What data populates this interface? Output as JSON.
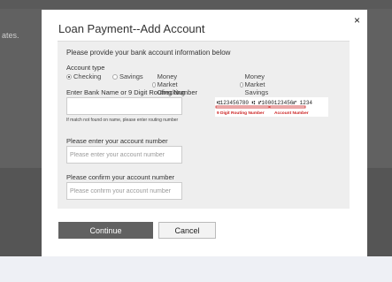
{
  "background": {
    "side_text": "ates."
  },
  "modal": {
    "title": "Loan Payment--Add Account",
    "close_glyph": "×",
    "intro": "Please provide your bank account information below",
    "account_type_label": "Account type",
    "account_types": [
      {
        "label": "Checking",
        "selected": true
      },
      {
        "label": "Savings",
        "selected": false
      },
      {
        "label": "Money Market Checking",
        "selected": false
      },
      {
        "label": "Money Market Savings",
        "selected": false
      }
    ],
    "bank_name_label": "Enter Bank Name or 9 Digit Routing Number",
    "bank_name_value": "",
    "bank_hint": "If match not found on name, please enter routing number",
    "check_image": {
      "micr_text": "⑆123456780 ⑆  ⑈1000123456⑈  1234",
      "routing_caption": "9 Digit Routing Number",
      "account_caption": "Account Number"
    },
    "account_number_label": "Please enter your account number",
    "account_number_placeholder": "Please enter your account number",
    "confirm_label": "Please confirm your account number",
    "confirm_placeholder": "Please confirm your account number",
    "continue_label": "Continue",
    "cancel_label": "Cancel"
  },
  "colors": {
    "primary_button": "#616161",
    "caption_red": "#cc2222"
  }
}
